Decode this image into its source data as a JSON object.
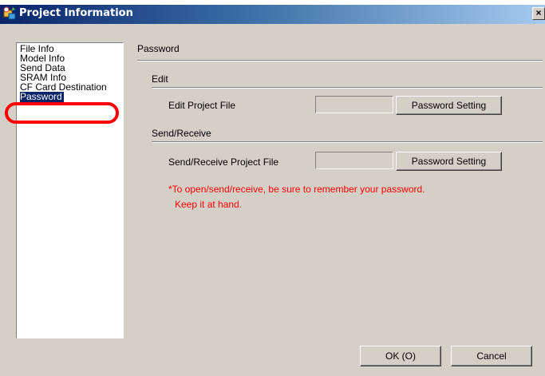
{
  "window": {
    "title": "Project Information",
    "close_label": "×"
  },
  "sidebar": {
    "items": [
      {
        "label": "File Info",
        "selected": false
      },
      {
        "label": "Model Info",
        "selected": false
      },
      {
        "label": "Send Data",
        "selected": false
      },
      {
        "label": "SRAM Info",
        "selected": false
      },
      {
        "label": "CF Card Destination",
        "selected": false
      },
      {
        "label": "Password",
        "selected": true
      }
    ]
  },
  "panel": {
    "title": "Password",
    "edit": {
      "heading": "Edit",
      "label": "Edit Project File",
      "value": "",
      "button": "Password Setting"
    },
    "send_receive": {
      "heading": "Send/Receive",
      "label": "Send/Receive Project File",
      "value": "",
      "button": "Password Setting"
    },
    "note_line1": "*To open/send/receive, be sure to remember your password.",
    "note_line2": "Keep it at hand."
  },
  "footer": {
    "ok": "OK (O)",
    "cancel": "Cancel"
  },
  "colors": {
    "title_bar_start": "#0a246a",
    "title_bar_end": "#a6caf0",
    "selection": "#0a246a",
    "note": "#ff0000",
    "highlight_ring": "#ff0000"
  }
}
